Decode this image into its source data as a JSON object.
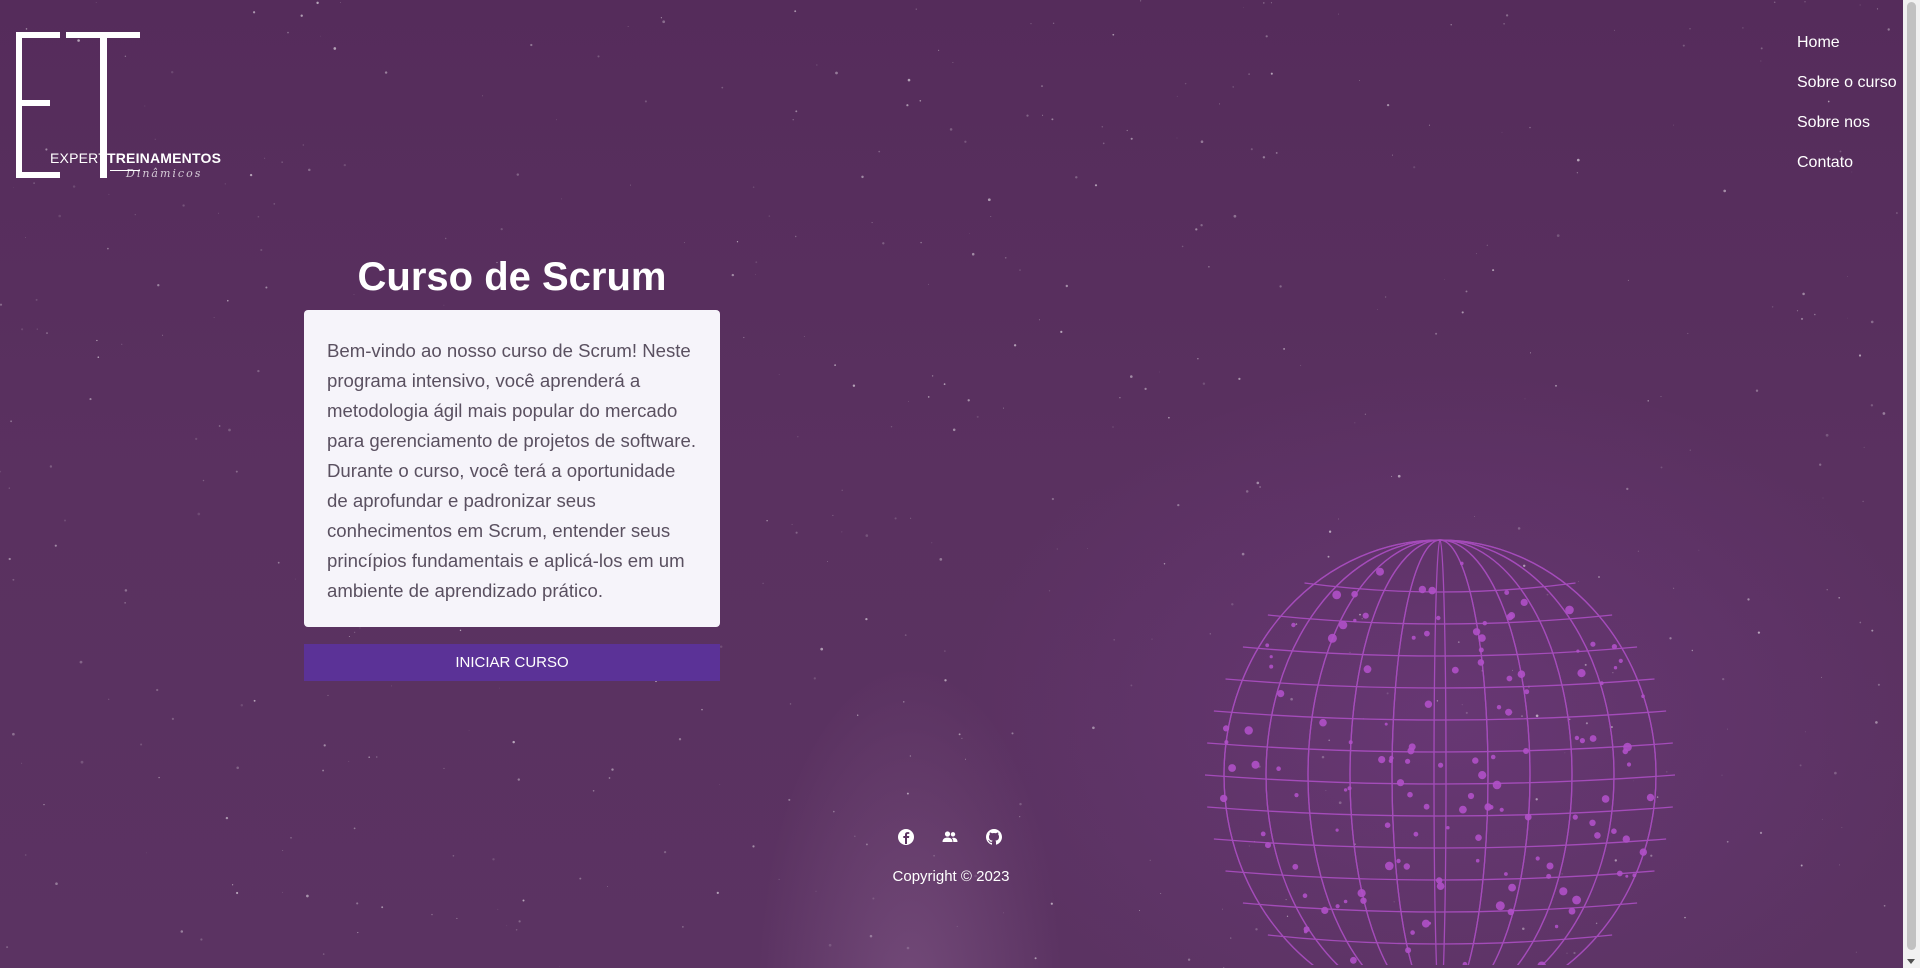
{
  "logo": {
    "word_thin": "EXPERT",
    "word_bold": "TREINAMENTOS",
    "script": "Dinâmicos"
  },
  "nav": {
    "items": [
      {
        "label": "Home"
      },
      {
        "label": "Sobre o curso"
      },
      {
        "label": "Sobre nos"
      },
      {
        "label": "Contato"
      }
    ]
  },
  "hero": {
    "title": "Curso de Scrum",
    "description": "Bem-vindo ao nosso curso de Scrum! Neste programa intensivo, você aprenderá a metodologia ágil mais popular do mercado para gerenciamento de projetos de software. Durante o curso, você terá a oportunidade de aprofundar e padronizar seus conhecimentos em Scrum, entender seus princípios fundamentais e aplicá-los em um ambiente de aprendizado prático.",
    "cta_label": "INICIAR CURSO"
  },
  "footer": {
    "social": [
      {
        "icon": "facebook-icon"
      },
      {
        "icon": "users-icon"
      },
      {
        "icon": "github-icon"
      }
    ],
    "copyright": "Copyright © 2023"
  },
  "colors": {
    "background": "#552c5b",
    "card": "#f6f4fa",
    "button": "#5b3297",
    "globe": "#b050c8"
  }
}
